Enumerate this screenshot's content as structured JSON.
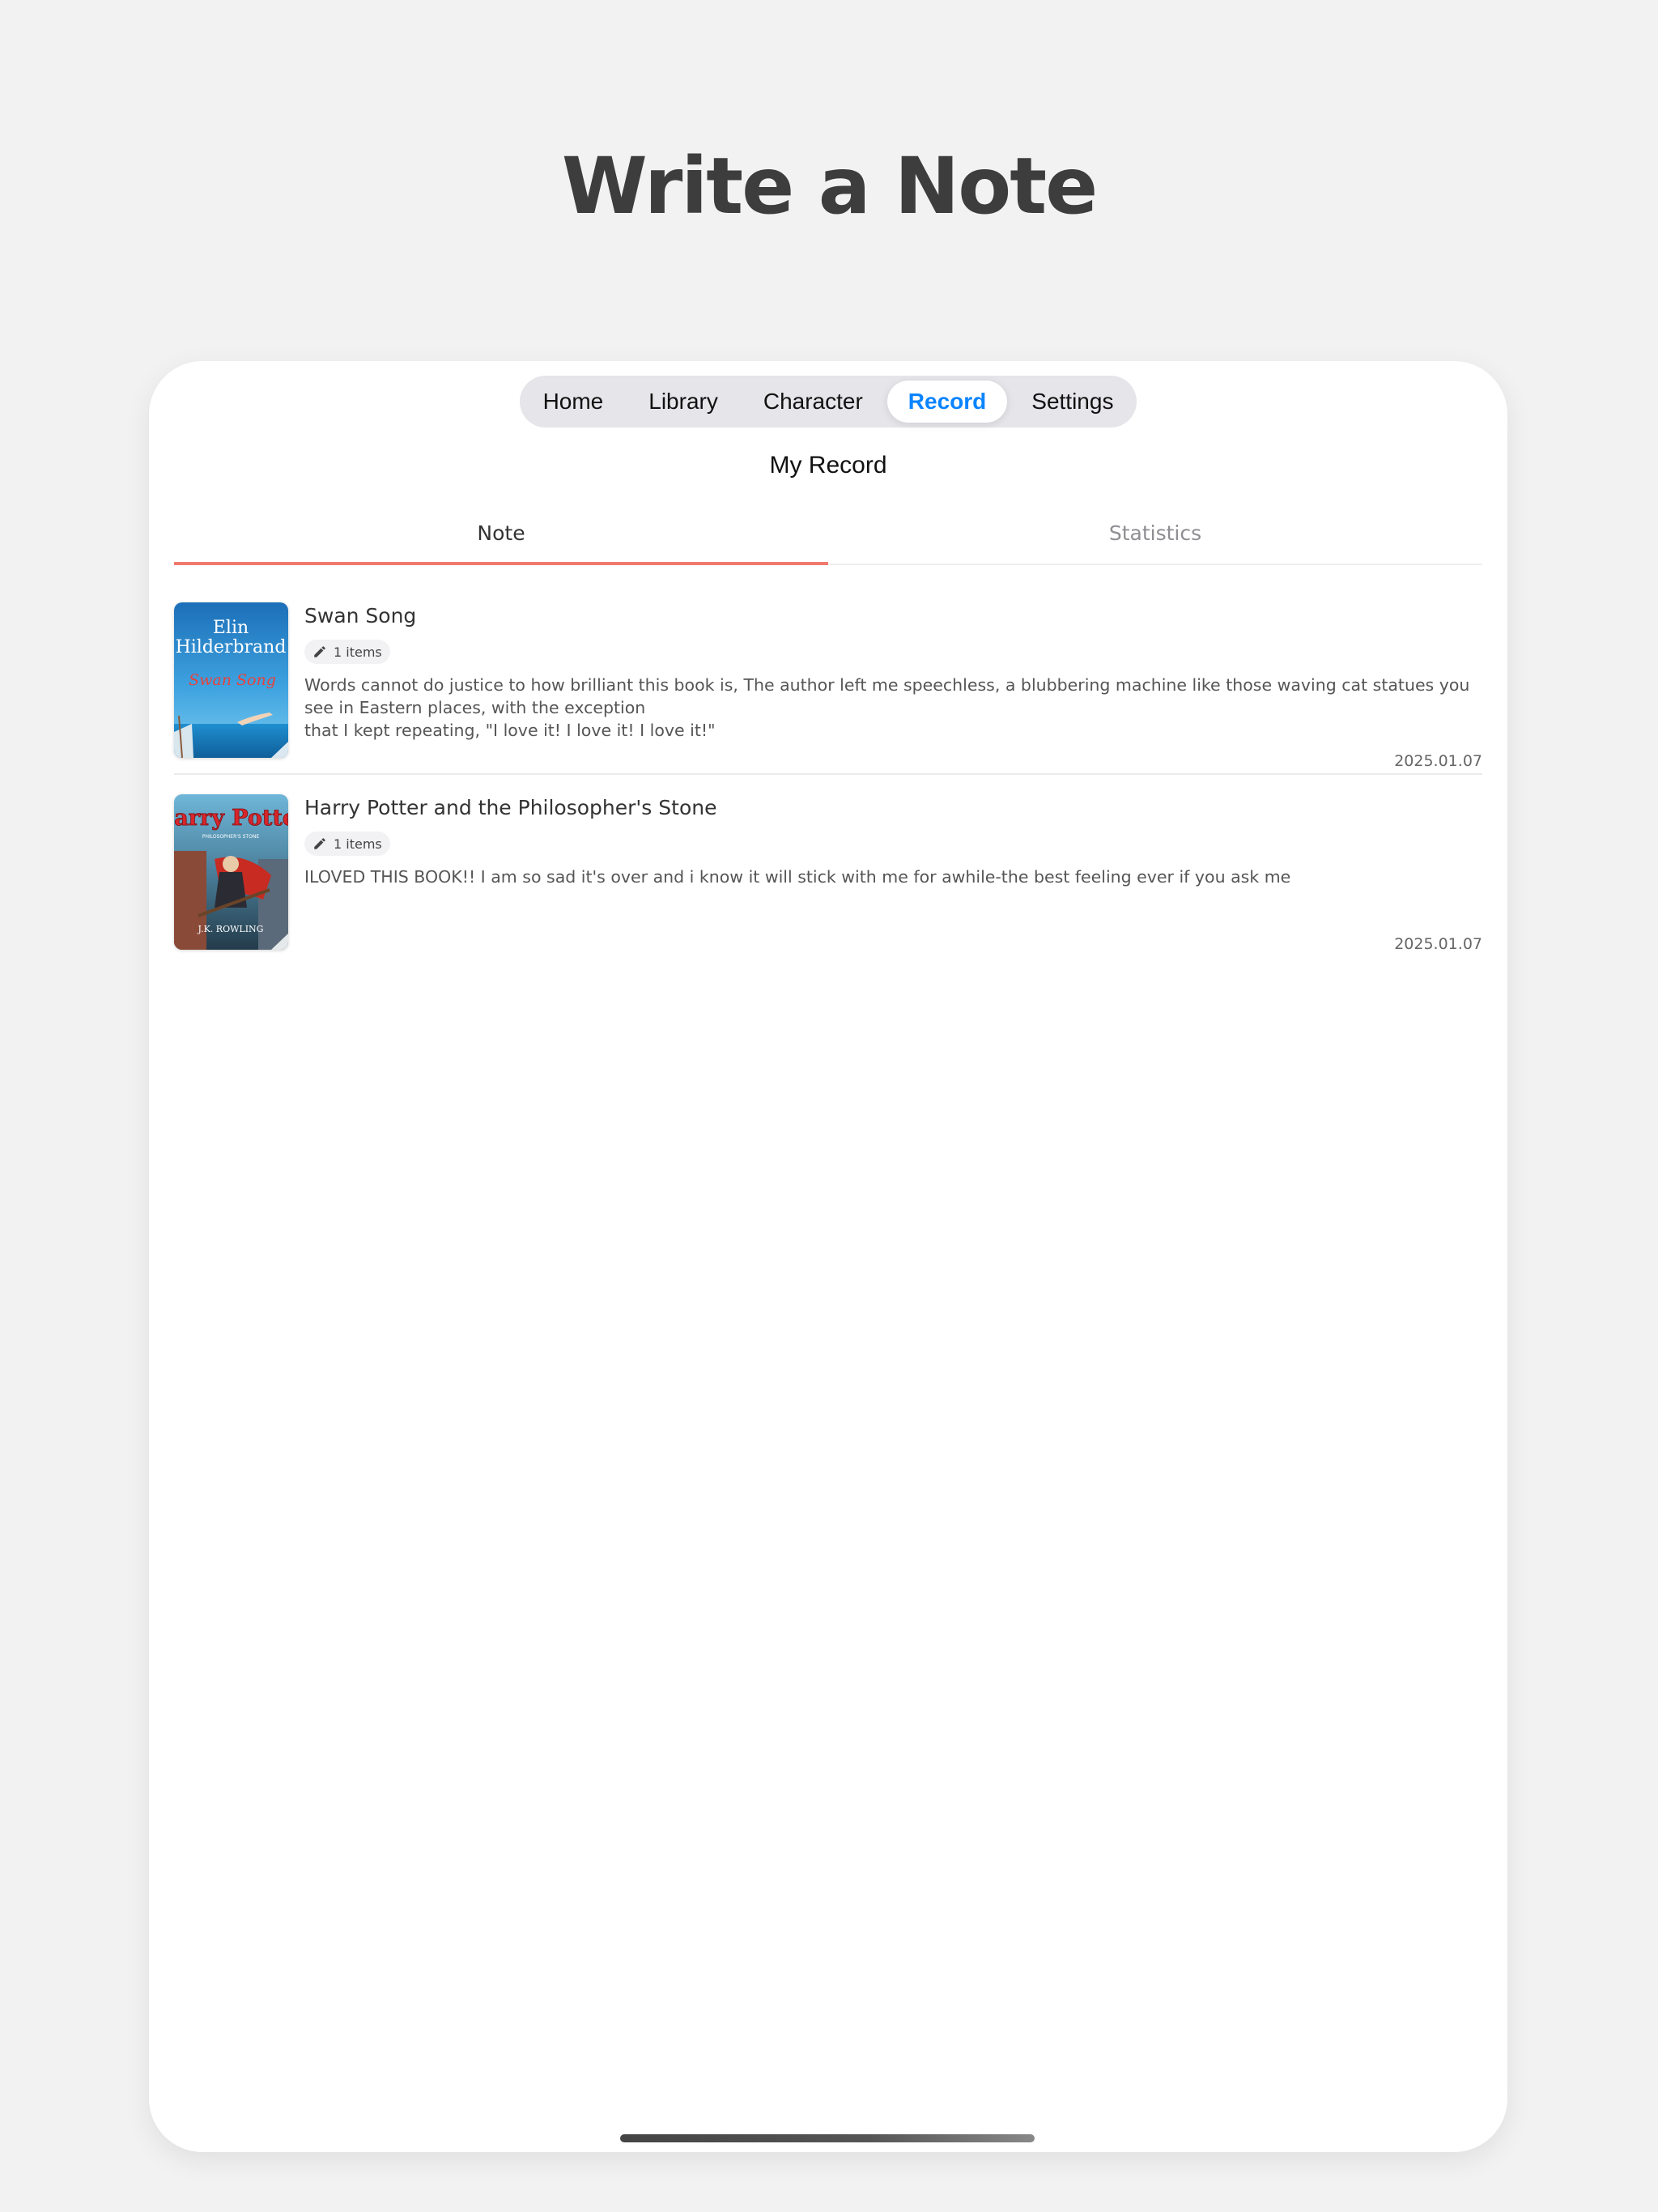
{
  "page": {
    "heading": "Write a Note"
  },
  "nav": {
    "items": [
      {
        "label": "Home",
        "active": false
      },
      {
        "label": "Library",
        "active": false
      },
      {
        "label": "Character",
        "active": false
      },
      {
        "label": "Record",
        "active": true
      },
      {
        "label": "Settings",
        "active": false
      }
    ]
  },
  "screen": {
    "title": "My Record"
  },
  "tabs": [
    {
      "label": "Note",
      "active": true
    },
    {
      "label": "Statistics",
      "active": false
    }
  ],
  "notes": [
    {
      "title": "Swan Song",
      "badge": "1 items",
      "text_line1": "Words cannot do justice to how brilliant this book is, The author left me speechless, a blubbering machine like those waving cat statues you see in Eastern places, with the exception",
      "text_line2": "that I kept repeating, \"I love it! I love it! I love it!\"",
      "date": "2025.01.07",
      "cover": {
        "author_line1": "Elin",
        "author_line2": "Hilderbrand",
        "title": "Swan Song"
      }
    },
    {
      "title": "Harry Potter and the Philosopher's Stone",
      "badge": "1 items",
      "text_line1": "ILOVED THIS BOOK!! I am so sad it's over and i know it will stick with me for awhile-the best feeling ever if you ask me",
      "date": "2025.01.07",
      "cover": {
        "title": "Harry Potter",
        "subtitle": "PHILOSOPHER'S STONE",
        "author": "J.K. ROWLING"
      }
    }
  ],
  "colors": {
    "accent_blue": "#0a84ff",
    "tab_underline": "#f07a6e",
    "background": "#f2f2f2"
  }
}
